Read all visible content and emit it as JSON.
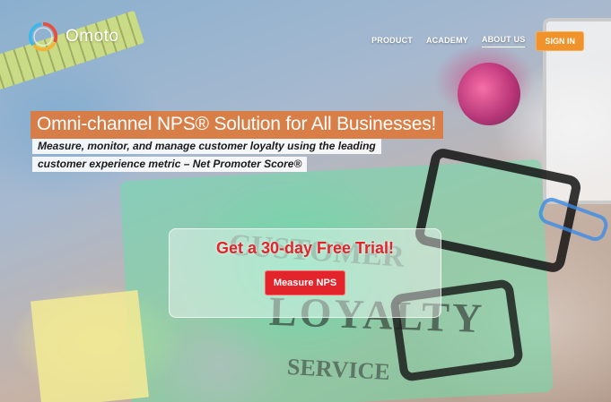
{
  "brand": {
    "name": "Omoto",
    "logo_icon": "ring-logo-icon"
  },
  "nav": {
    "items": [
      {
        "label": "PRODUCT"
      },
      {
        "label": "ACADEMY"
      },
      {
        "label": "ABOUT US",
        "active": true
      }
    ],
    "signin_label": "SIGN IN"
  },
  "hero": {
    "headline": "Omni-channel NPS® Solution for All Businesses!",
    "subline_1": "Measure, monitor, and manage customer loyalty using the leading",
    "subline_2": "customer experience metric – Net Promoter Score®",
    "background_words": {
      "customer": "CUSTOMER",
      "loyalty": "LOYALTY",
      "service": "SERVICE"
    }
  },
  "trial": {
    "title": "Get a 30-day Free Trial!",
    "button_label": "Measure NPS"
  },
  "colors": {
    "accent_orange": "#f0932b",
    "headline_bg": "#dc783c",
    "cta_red": "#e3242b"
  }
}
